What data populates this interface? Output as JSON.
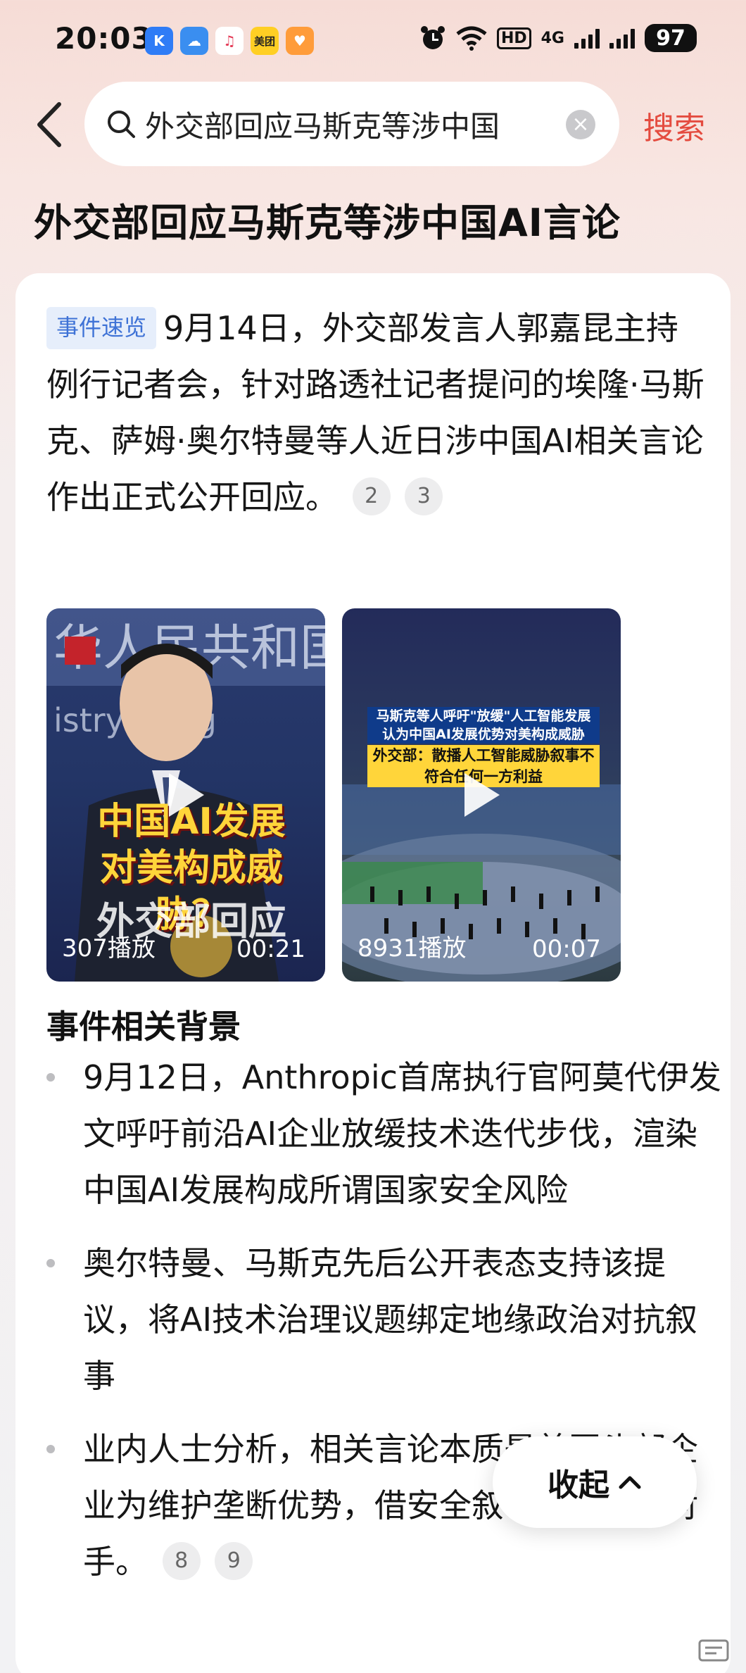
{
  "status_bar": {
    "time": "20:03",
    "app_icons": [
      {
        "name": "k-app-icon",
        "text": "K",
        "color": "#2f7cf6"
      },
      {
        "name": "cloud-app-icon",
        "text": "☁",
        "color": "#3a8ef0"
      },
      {
        "name": "music-app-icon",
        "text": "♫",
        "color": "#ffffff"
      },
      {
        "name": "meituan-app-icon",
        "text": "美团",
        "color": "#ffcf24"
      },
      {
        "name": "heart-app-icon",
        "text": "♥",
        "color": "#ff9c3a"
      }
    ],
    "network_hd": "HD",
    "network_gen": "4G",
    "battery": "97"
  },
  "search": {
    "query": "外交部回应马斯克等涉中国",
    "button_label": "搜索"
  },
  "page_title": "外交部回应马斯克等涉中国AI言论",
  "summary": {
    "tag": "事件速览",
    "text": "9月14日，外交部发言人郭嘉昆主持例行记者会，针对路透社记者提问的埃隆·马斯克、萨姆·奥尔特曼等人近日涉中国AI相关言论作出正式公开回应。",
    "refs": [
      "2",
      "3"
    ]
  },
  "videos": [
    {
      "views": "307播放",
      "duration": "00:21",
      "caption_lines": [
        "中国AI发展",
        "对美构成威胁？"
      ],
      "caption_bottom": "外交部回应"
    },
    {
      "views": "8931播放",
      "duration": "00:07",
      "caption_lines": [
        "马斯克等人呼吁\"放缓\"人工智能发展",
        "认为中国AI发展优势对美构成威胁",
        "外交部：散播人工智能威胁叙事不符合任何一方利益"
      ]
    }
  ],
  "background": {
    "heading": "事件相关背景",
    "items": [
      {
        "text": "9月12日，Anthropic首席执行官阿莫代伊发文呼吁前沿AI企业放缓技术迭代步伐，渲染中国AI发展构成所谓国家安全风险",
        "refs": []
      },
      {
        "text": "奥尔特曼、马斯克先后公开表态支持该提议，将AI技术治理议题绑定地缘政治对抗叙事",
        "refs": []
      },
      {
        "text": "业内人士分析，相关言论本质是美国头部企业为维护垄断优势，借安全叙事打压竞争对手。",
        "refs": [
          "8",
          "9"
        ]
      }
    ]
  },
  "collapse_label": "收起"
}
